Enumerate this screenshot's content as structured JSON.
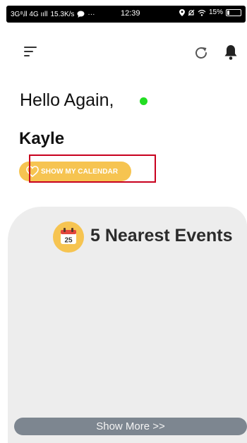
{
  "status_bar": {
    "network": "3G⁸ᵢll 4G ııll",
    "speed": "15.3K/s",
    "more": "···",
    "time": "12:39",
    "battery": "15%"
  },
  "header": {
    "menu_icon": "hamburger-menu-icon",
    "refresh_icon": "refresh-icon",
    "bell_icon": "bell-icon"
  },
  "greeting": {
    "text": "Hello Again,",
    "online_color": "#22dd22",
    "name": "Kayle"
  },
  "calendar_button": {
    "label": "SHOW MY CALENDAR",
    "color": "#f6c451"
  },
  "events": {
    "title": "5 Nearest Events",
    "icon_day": "25",
    "show_more": "Show More >>"
  }
}
